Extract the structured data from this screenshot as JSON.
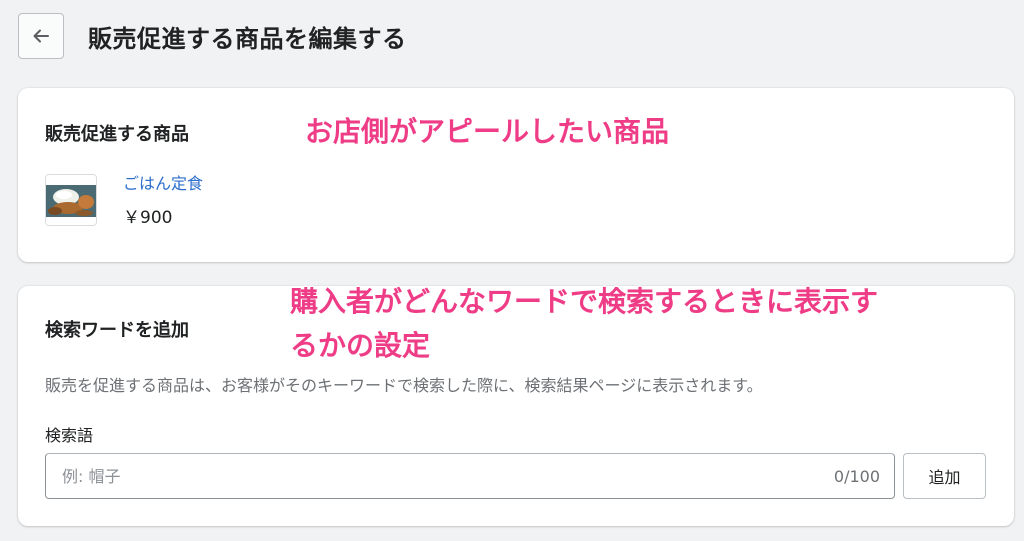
{
  "header": {
    "back_icon": "arrow-left-icon",
    "title": "販売促進する商品を編集する"
  },
  "promoted_card": {
    "title": "販売促進する商品",
    "product": {
      "name": "ごはん定食",
      "price": "￥900",
      "thumbnail": "rice-set-meal-photo"
    }
  },
  "keyword_card": {
    "title": "検索ワードを追加",
    "description": "販売を促進する商品は、お客様がそのキーワードで検索した際に、検索結果ページに表示されます。",
    "field_label": "検索語",
    "input": {
      "placeholder": "例: 帽子",
      "value": "",
      "char_count": "0/100"
    },
    "add_button": "追加"
  },
  "annotations": {
    "product_note": "お店側がアピールしたい商品",
    "keyword_note_line1": "購入者がどんなワードで検索するときに表示す",
    "keyword_note_line2": "るかの設定",
    "color": "#ee3d86"
  },
  "colors": {
    "background": "#f1f2f3",
    "link": "#2c6ecb",
    "subdued_text": "#6d7175"
  }
}
